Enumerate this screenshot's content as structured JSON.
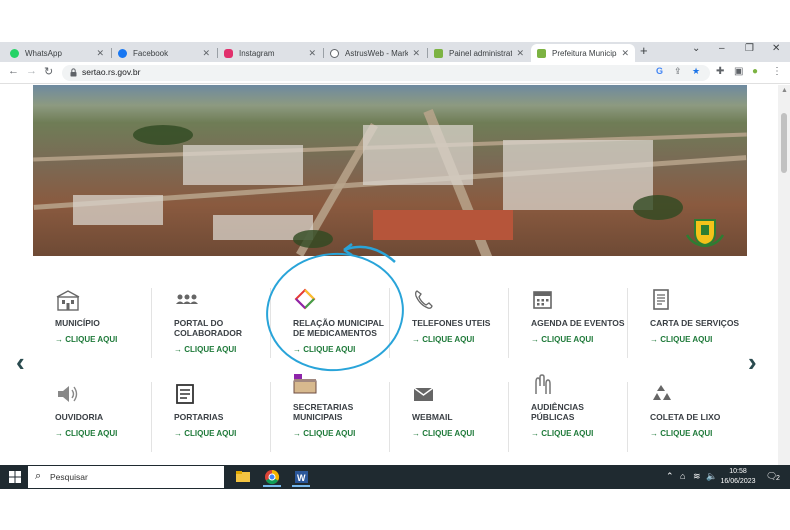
{
  "browser": {
    "tabs": [
      {
        "title": "WhatsApp",
        "icon": "whatsapp-icon",
        "color": "#25d366"
      },
      {
        "title": "Facebook",
        "icon": "facebook-icon",
        "color": "#1877f2"
      },
      {
        "title": "Instagram",
        "icon": "instagram-icon",
        "color": "#e1306c"
      },
      {
        "title": "AstrusWeb - Marketin",
        "icon": "globe-icon",
        "color": "#5f6368"
      },
      {
        "title": "Painel administrativo",
        "icon": "shield-icon",
        "color": "#7cb342"
      },
      {
        "title": "Prefeitura Municipal d",
        "icon": "shield-icon",
        "color": "#7cb342"
      }
    ],
    "url": "sertao.rs.gov.br",
    "new_tab_symbol": "+",
    "window_controls": {
      "chevron": "⌄",
      "minimize": "–",
      "restore": "❐",
      "close": "✕"
    }
  },
  "page": {
    "carousel": {
      "prev": "‹",
      "next": "›"
    },
    "tiles_row1": [
      {
        "label1": "MUNICÍPIO",
        "label2": "",
        "link": "→ CLIQUE AQUI",
        "icon": "building-icon"
      },
      {
        "label1": "PORTAL DO",
        "label2": "COLABORADOR",
        "link": "→ CLIQUE AQUI",
        "icon": "people-icon"
      },
      {
        "label1": "RELAÇÃO MUNICIPAL",
        "label2": "DE MEDICAMENTOS",
        "link": "→ CLIQUE AQUI",
        "icon": "diamond-icon"
      },
      {
        "label1": "TELEFONES UTEIS",
        "label2": "",
        "link": "→ CLIQUE AQUI",
        "icon": "phone-icon"
      },
      {
        "label1": "AGENDA DE EVENTOS",
        "label2": "",
        "link": "→ CLIQUE AQUI",
        "icon": "calendar-icon"
      },
      {
        "label1": "CARTA DE SERVIÇOS",
        "label2": "",
        "link": "→ CLIQUE AQUI",
        "icon": "document-icon"
      }
    ],
    "tiles_row2": [
      {
        "label1": "OUVIDORIA",
        "label2": "",
        "link": "→ CLIQUE AQUI",
        "icon": "speaker-icon"
      },
      {
        "label1": "PORTARIAS",
        "label2": "",
        "link": "→ CLIQUE AQUI",
        "icon": "register-icon"
      },
      {
        "label1": "SECRETARIAS",
        "label2": "MUNICIPAIS",
        "link": "→ CLIQUE AQUI",
        "icon": "folder-icon"
      },
      {
        "label1": "WEBMAIL",
        "label2": "",
        "link": "→ CLIQUE AQUI",
        "icon": "mail-icon"
      },
      {
        "label1": "AUDIÊNCIAS",
        "label2": "PÚBLICAS",
        "link": "→ CLIQUE AQUI",
        "icon": "hands-icon"
      },
      {
        "label1": "COLETA DE LIXO",
        "label2": "",
        "link": "→ CLIQUE AQUI",
        "icon": "recycle-icon"
      }
    ]
  },
  "taskbar": {
    "search_placeholder": "Pesquisar",
    "time": "10:58",
    "date": "16/06/2023",
    "notification_count": "2"
  },
  "colors": {
    "link_green": "#1f7a3a",
    "annotation_blue": "#29a4d9",
    "taskbar_dark": "#1f2a30"
  }
}
